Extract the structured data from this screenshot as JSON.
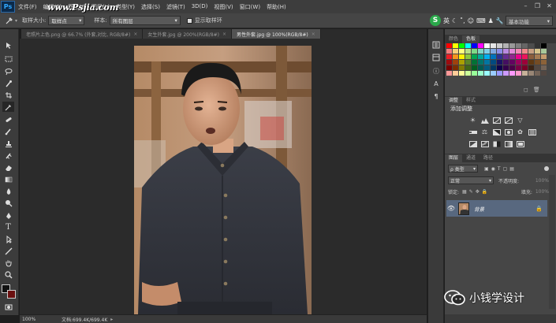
{
  "app": {
    "logo": "Ps"
  },
  "menu": [
    "文件(F)",
    "编辑(E)",
    "图像(I)",
    "图层(L)",
    "类型(Y)",
    "选择(S)",
    "滤镜(T)",
    "3D(D)",
    "视图(V)",
    "窗口(W)",
    "帮助(H)"
  ],
  "watermark_url": "www.Psjia.com",
  "options_bar": {
    "sample_size_label": "取样大小:",
    "sample_size_value": "取样点",
    "sample_label": "样本:",
    "sample_value": "所有图层",
    "show_ring_label": "显示取样环",
    "ime_label": "英",
    "workspace": "基本功能"
  },
  "tabs": [
    {
      "title": "老照片上色.png @ 66.7% (外套,对比, RGB/8#)",
      "active": false
    },
    {
      "title": "女生外套.jpg @ 200%(RGB/8#)",
      "active": false
    },
    {
      "title": "男性外套.jpg @ 100%(RGB/8#)",
      "active": true
    }
  ],
  "status": {
    "zoom": "100%",
    "doc_info": "文档:699.4K/699.4K"
  },
  "panels": {
    "top_tabs": [
      "颜色",
      "色板"
    ],
    "top_active": 1,
    "adj_tabs": [
      "调整",
      "样式"
    ],
    "adj_active": 0,
    "adj_title": "添加调整",
    "layer_tabs": [
      "图层",
      "通道",
      "路径"
    ],
    "layer_active": 0,
    "filter_kind": "ρ 类型",
    "blend_mode": "正常",
    "opacity_label": "不透明度:",
    "opacity_value": "100%",
    "lock_label": "锁定:",
    "fill_label": "填充:",
    "fill_value": "100%",
    "layer_name": "背景"
  },
  "swatch_colors": [
    "#ff0000",
    "#ffff00",
    "#00ff00",
    "#00ffff",
    "#0000ff",
    "#ff00ff",
    "#ffffff",
    "#e6e6e6",
    "#cccccc",
    "#b3b3b3",
    "#999999",
    "#808080",
    "#666666",
    "#4d4d4d",
    "#333333",
    "#000000",
    "#f27d7d",
    "#f7d07a",
    "#ffff80",
    "#b8e186",
    "#7ed987",
    "#7fd6c6",
    "#7fcfe8",
    "#80a8e0",
    "#8c8ce6",
    "#b98ae0",
    "#e28bd8",
    "#f08bb4",
    "#ee8a8a",
    "#c8a082",
    "#d6c48a",
    "#a8c89a",
    "#ee1c24",
    "#f7941d",
    "#fff200",
    "#8dc63f",
    "#00a651",
    "#00a99d",
    "#00aeef",
    "#0072bc",
    "#2e3192",
    "#662d91",
    "#92278f",
    "#ec008c",
    "#ed145b",
    "#8b5e3c",
    "#a67c52",
    "#c69c6d",
    "#9e0b0f",
    "#a0410d",
    "#aba000",
    "#598527",
    "#007236",
    "#00746b",
    "#0076a3",
    "#004a80",
    "#1b1464",
    "#440e62",
    "#630460",
    "#9e005d",
    "#9e0039",
    "#603913",
    "#754c24",
    "#8c6239",
    "#790000",
    "#7b2e00",
    "#827b00",
    "#406618",
    "#005e20",
    "#005952",
    "#005b7f",
    "#003663",
    "#0d004c",
    "#32004b",
    "#4b0049",
    "#7b0046",
    "#7a0026",
    "#3c2415",
    "#534741",
    "#736357",
    "#ff9999",
    "#ffcc99",
    "#ffff99",
    "#ccff99",
    "#99ff99",
    "#99ffcc",
    "#99ffff",
    "#99ccff",
    "#9999ff",
    "#cc99ff",
    "#ff99ff",
    "#ff99cc",
    "#c7b299",
    "#998675",
    "#736357",
    "#534741"
  ],
  "wechat_watermark": "小钱学设计"
}
